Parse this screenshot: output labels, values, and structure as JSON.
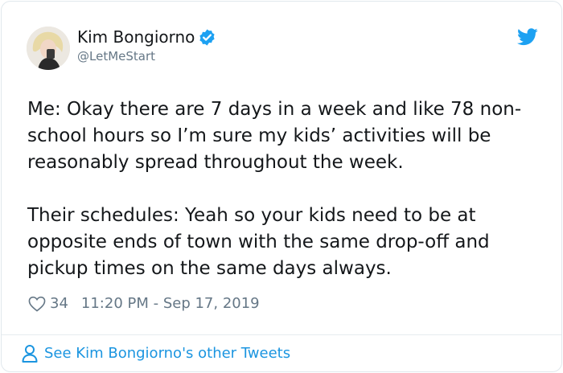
{
  "tweet": {
    "author_name": "Kim Bongiorno",
    "handle": "@LetMeStart",
    "paragraphs": [
      "Me: Okay there are 7 days in a week and like 78 non-school hours so I’m sure my kids’ activities will be reasonably spread throughout the week.",
      "Their schedules: Yeah so your kids need to be at opposite ends of town with the same drop-off and pickup times on the same days always."
    ],
    "likes": "34",
    "timestamp": "11:20 PM - Sep 17, 2019"
  },
  "footer": {
    "link_text": "See Kim Bongiorno's other Tweets"
  },
  "icons": {
    "verified": "verified-badge-icon",
    "brand": "twitter-bird-icon",
    "like": "heart-icon",
    "profile": "person-icon"
  },
  "colors": {
    "accent": "#1da1f2",
    "link": "#1b95e0",
    "muted": "#657786",
    "text": "#14171a"
  }
}
